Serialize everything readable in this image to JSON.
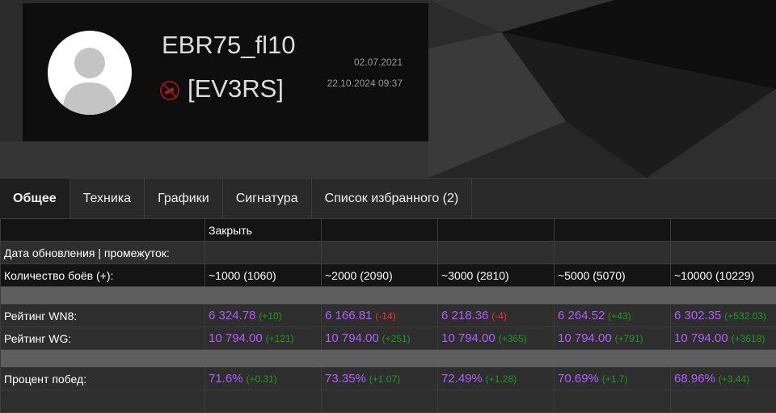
{
  "player": {
    "name": "EBR75_fl10",
    "clan": "[EV3RS]",
    "created": "02.07.2021",
    "updated": "22.10.2024 09:37"
  },
  "tabs": [
    "Общее",
    "Техника",
    "Графики",
    "Сигнатура",
    "Список избранного (2)"
  ],
  "table": {
    "close_label": "Закрыть",
    "rows": {
      "date_label": "Дата обновления | промежуток:",
      "battles_label": "Количество боёв (+):",
      "battles": [
        "~1000 (1060)",
        "~2000 (2090)",
        "~3000 (2810)",
        "~5000 (5070)",
        "~10000 (10229)"
      ],
      "wn8_label": "Рейтинг WN8:",
      "wn8": [
        {
          "v": "6 324.78",
          "d": "(+10)",
          "neg": false
        },
        {
          "v": "6 166.81",
          "d": "(-14)",
          "neg": true
        },
        {
          "v": "6 218.36",
          "d": "(-4)",
          "neg": true
        },
        {
          "v": "6 264.52",
          "d": "(+43)",
          "neg": false
        },
        {
          "v": "6 302.35",
          "d": "(+532.03)",
          "neg": false
        }
      ],
      "wg_label": "Рейтинг WG:",
      "wg": [
        {
          "v": "10 794.00",
          "d": "(+121)"
        },
        {
          "v": "10 794.00",
          "d": "(+251)"
        },
        {
          "v": "10 794.00",
          "d": "(+365)"
        },
        {
          "v": "10 794.00",
          "d": "(+791)"
        },
        {
          "v": "10 794.00",
          "d": "(+3618)"
        }
      ],
      "win_label": "Процент побед:",
      "win": [
        {
          "v": "71.6%",
          "d": "(+0.31)"
        },
        {
          "v": "73.35%",
          "d": "(+1.07)"
        },
        {
          "v": "72.49%",
          "d": "(+1.28)"
        },
        {
          "v": "70.69%",
          "d": "(+1.7)"
        },
        {
          "v": "68.96%",
          "d": "(+3.44)"
        }
      ]
    }
  },
  "colors": {
    "value": "#b05cff",
    "positive": "#1f9a1f",
    "negative": "#ff2a2a"
  }
}
